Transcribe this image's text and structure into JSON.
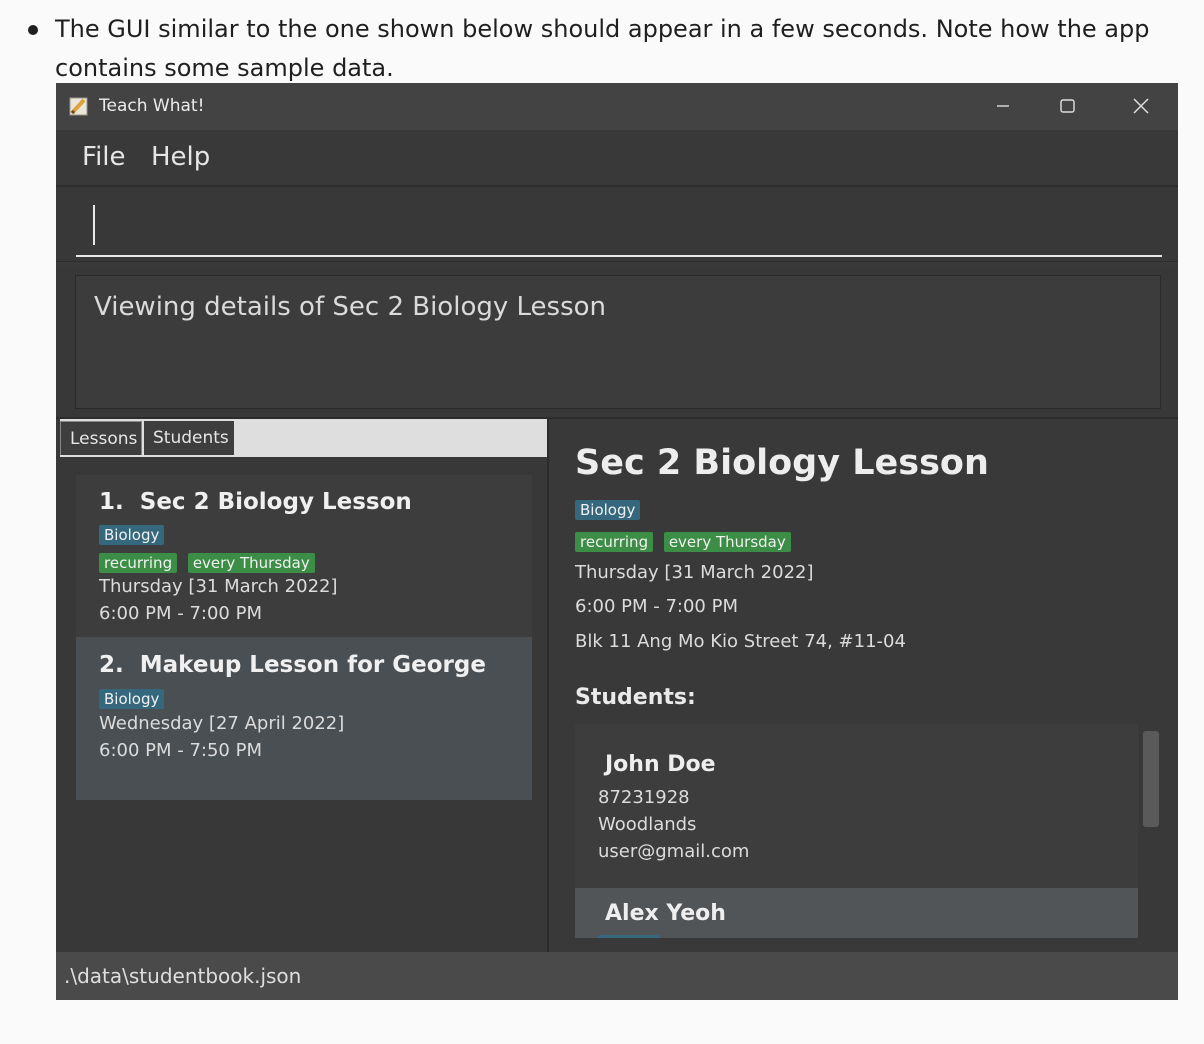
{
  "doc": {
    "bullet_text": "The GUI similar to the one shown below should appear in a few seconds. Note how the app contains some sample data."
  },
  "window": {
    "title": "Teach What!",
    "controls": {
      "minimize": "minimize-icon",
      "maximize": "maximize-icon",
      "close": "close-icon"
    }
  },
  "menu": {
    "items": [
      "File",
      "Help"
    ]
  },
  "command": {
    "value": ""
  },
  "result": {
    "text": "Viewing details of Sec 2 Biology Lesson"
  },
  "tabs": [
    "Lessons",
    "Students"
  ],
  "lessons": [
    {
      "index": "1.",
      "name": "Sec 2 Biology Lesson",
      "subject": "Biology",
      "tags": [
        "recurring",
        "every Thursday"
      ],
      "date": "Thursday [31 March 2022]",
      "time": "6:00 PM - 7:00 PM"
    },
    {
      "index": "2.",
      "name": "Makeup Lesson for George",
      "subject": "Biology",
      "tags": [],
      "date": "Wednesday [27 April 2022]",
      "time": "6:00 PM - 7:50 PM"
    }
  ],
  "detail": {
    "title": "Sec 2 Biology Lesson",
    "subject": "Biology",
    "tags": [
      "recurring",
      "every Thursday"
    ],
    "date": "Thursday [31 March 2022]",
    "time": "6:00 PM - 7:00 PM",
    "address": "Blk 11 Ang Mo Kio Street 74, #11-04",
    "students_heading": "Students:",
    "students": [
      {
        "name": "John Doe",
        "phone": "87231928",
        "address": "Woodlands",
        "email": "user@gmail.com"
      },
      {
        "name": "Alex Yeoh"
      }
    ]
  },
  "status": {
    "path": ".\\data\\studentbook.json"
  },
  "colors": {
    "window_bg": "#3a3a3a",
    "tag_blue": "#35687c",
    "tag_green": "#3c8d45",
    "selected_card": "#4a4f53"
  }
}
